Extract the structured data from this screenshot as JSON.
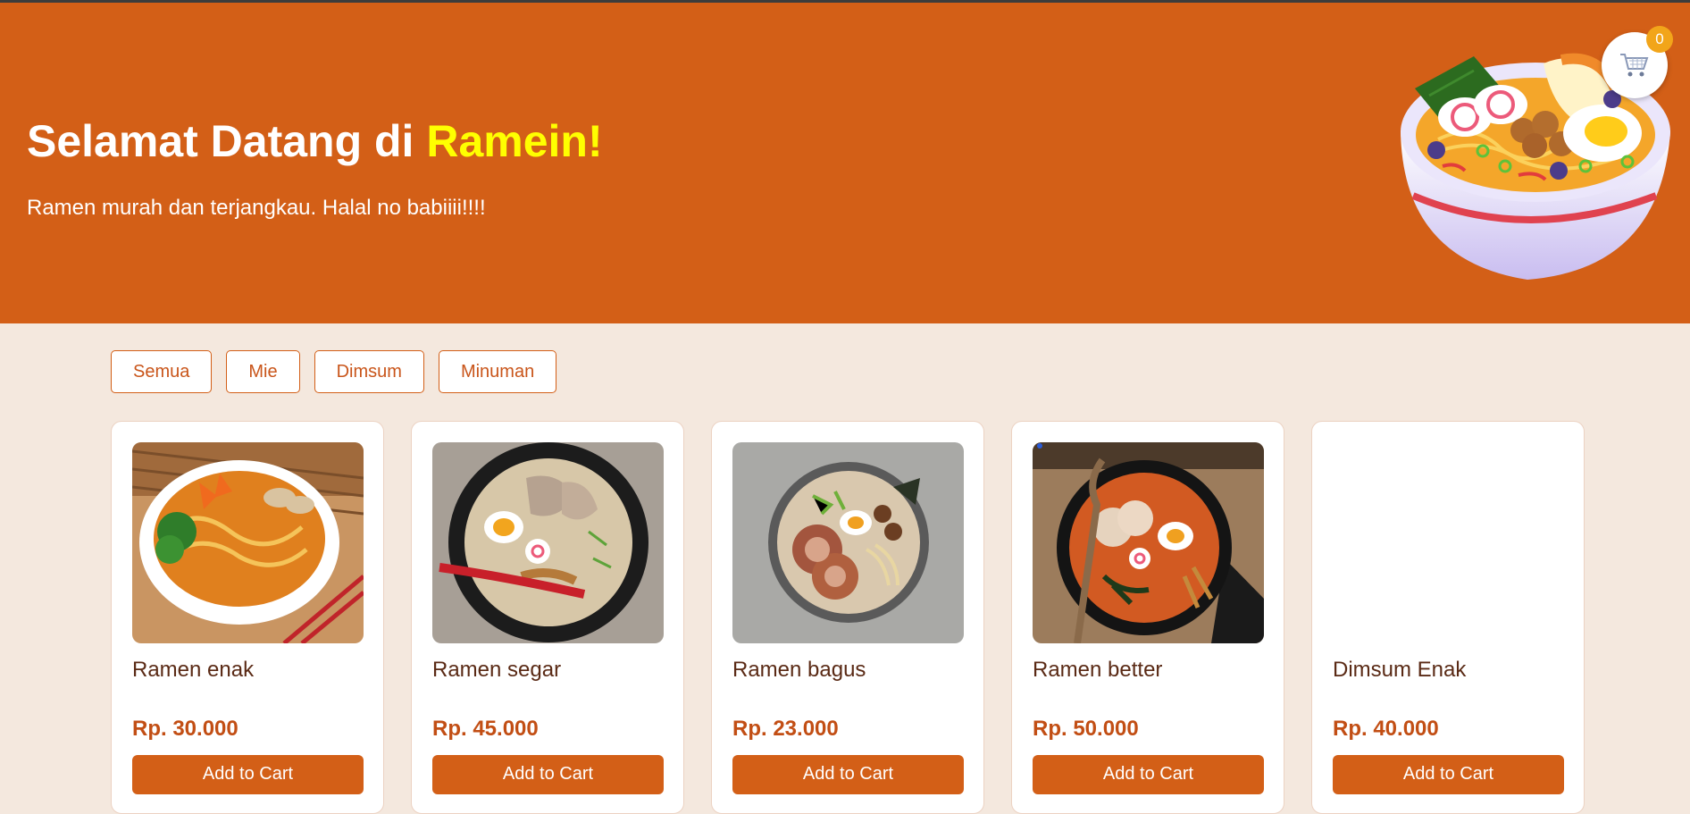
{
  "hero": {
    "title_prefix": "Selamat Datang di ",
    "title_brand": "Ramein!",
    "subtitle": "Ramen murah dan terjangkau. Halal no babiiii!!!!",
    "illustration": "ramen-bowl-illustration"
  },
  "cart": {
    "icon": "cart-icon",
    "count": "0"
  },
  "filters": [
    "Semua",
    "Mie",
    "Dimsum",
    "Minuman"
  ],
  "products": [
    {
      "name": "Ramen enak",
      "price": "Rp. 30.000",
      "button": "Add to Cart"
    },
    {
      "name": "Ramen segar",
      "price": "Rp. 45.000",
      "button": "Add to Cart"
    },
    {
      "name": "Ramen bagus",
      "price": "Rp. 23.000",
      "button": "Add to Cart"
    },
    {
      "name": "Ramen better",
      "price": "Rp. 50.000",
      "button": "Add to Cart"
    },
    {
      "name": "Dimsum Enak",
      "price": "Rp. 40.000",
      "button": "Add to Cart"
    }
  ],
  "colors": {
    "brand": "#d35f17",
    "brand_highlight": "#ffff00",
    "background": "#f4e8de",
    "badge": "#f2a51a"
  }
}
